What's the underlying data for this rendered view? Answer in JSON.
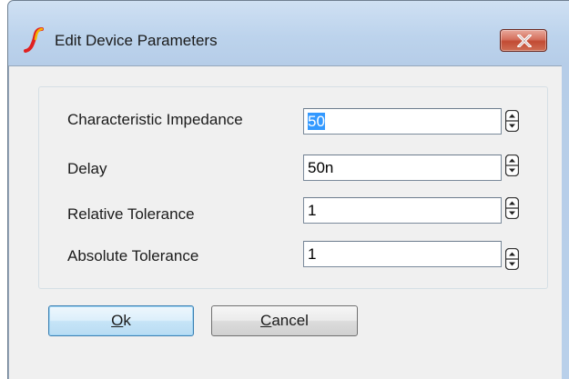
{
  "window": {
    "title": "Edit Device Parameters"
  },
  "parameters": [
    {
      "label": "Characteristic Impedance",
      "value": "50",
      "selected": true
    },
    {
      "label": "Delay",
      "value": "50n",
      "selected": false
    },
    {
      "label": "Relative Tolerance",
      "value": "1",
      "selected": false
    },
    {
      "label": "Absolute Tolerance",
      "value": "1",
      "selected": false
    }
  ],
  "buttons": {
    "ok": {
      "mnemonic": "O",
      "rest": "k"
    },
    "cancel": {
      "mnemonic": "C",
      "rest": "ancel"
    }
  },
  "icons": {
    "app": "simetrix-app-icon",
    "close": "close-icon",
    "spinner": "up-down-spinner-icon"
  },
  "colors": {
    "selection": "#3399ff",
    "close_button": "#c24b33",
    "default_button_border": "#3c7fb1"
  }
}
